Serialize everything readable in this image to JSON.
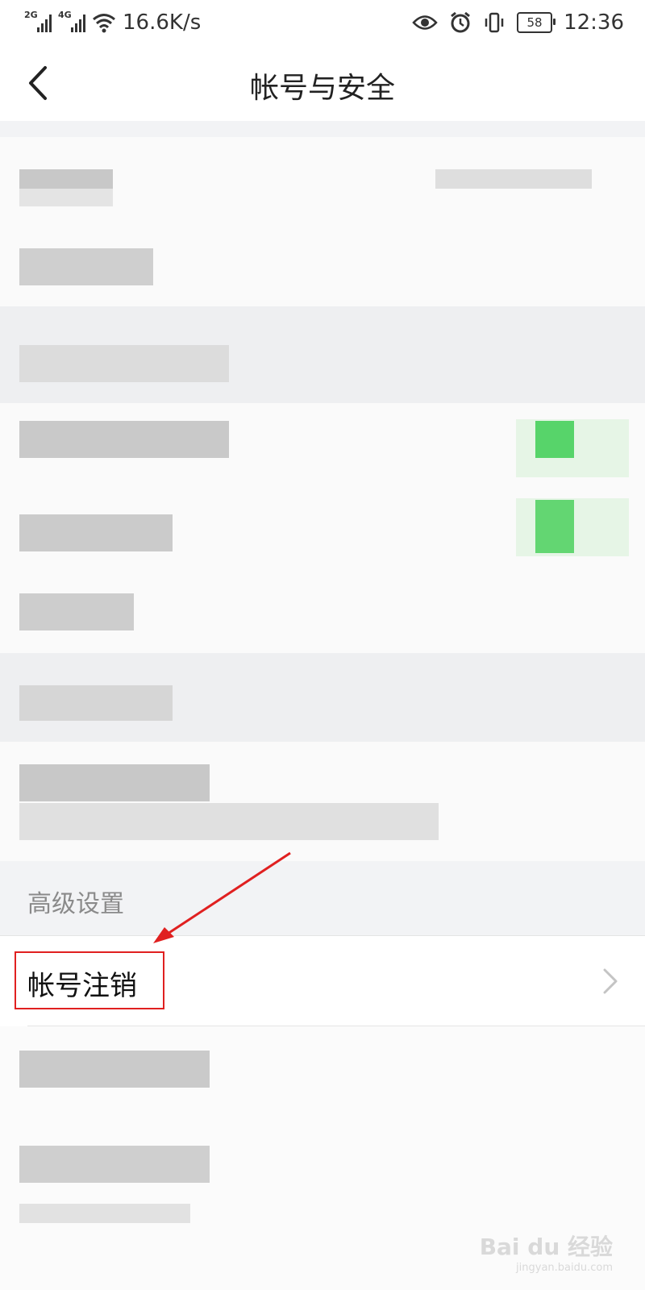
{
  "status_bar": {
    "sig1": "2G",
    "sig2": "4G",
    "net_speed": "16.6K/s",
    "battery": "58",
    "time": "12:36"
  },
  "header": {
    "title": "帐号与安全",
    "back_icon": "chevron-left-icon"
  },
  "advanced": {
    "section_title": "高级设置",
    "cancel_account_label": "帐号注销",
    "chevron_icon": "chevron-right-icon"
  },
  "annotation": {
    "highlight_color": "#e02020"
  },
  "watermark": {
    "brand": "Bai du 经验",
    "url": "jingyan.baidu.com"
  }
}
